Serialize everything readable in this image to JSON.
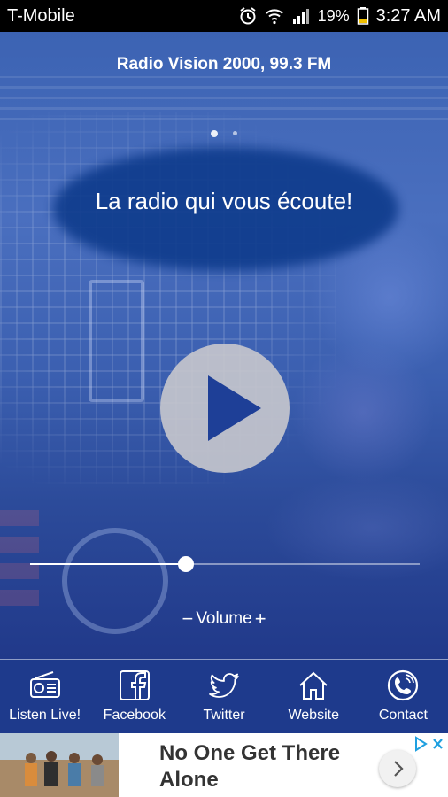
{
  "status_bar": {
    "carrier": "T-Mobile",
    "battery": "19%",
    "time": "3:27 AM",
    "icons": [
      "alarm-icon",
      "wifi-icon",
      "signal-icon",
      "battery-icon"
    ]
  },
  "player": {
    "station_title": "Radio Vision 2000, 99.3 FM",
    "tagline": "La radio qui vous écoute!",
    "pager": {
      "pages": 2,
      "active": 0
    },
    "volume": {
      "minus": "−",
      "label": "Volume",
      "plus": "+",
      "level": 0.4
    },
    "play_icon": "play-icon"
  },
  "tabs": [
    {
      "label": "Listen Live!",
      "icon": "radio-icon"
    },
    {
      "label": "Facebook",
      "icon": "facebook-icon"
    },
    {
      "label": "Twitter",
      "icon": "twitter-icon"
    },
    {
      "label": "Website",
      "icon": "home-icon"
    },
    {
      "label": "Contact",
      "icon": "phone-icon"
    }
  ],
  "ad": {
    "headline": "No One Get There Alone",
    "arrow_icon": "chevron-right-icon",
    "adchoices_icon": "adchoices-icon"
  },
  "colors": {
    "tab_bar": "#1e3a8c",
    "background": "#3c63b3",
    "tagline_blob": "#0e3b8c",
    "accent": "#ffffff"
  }
}
